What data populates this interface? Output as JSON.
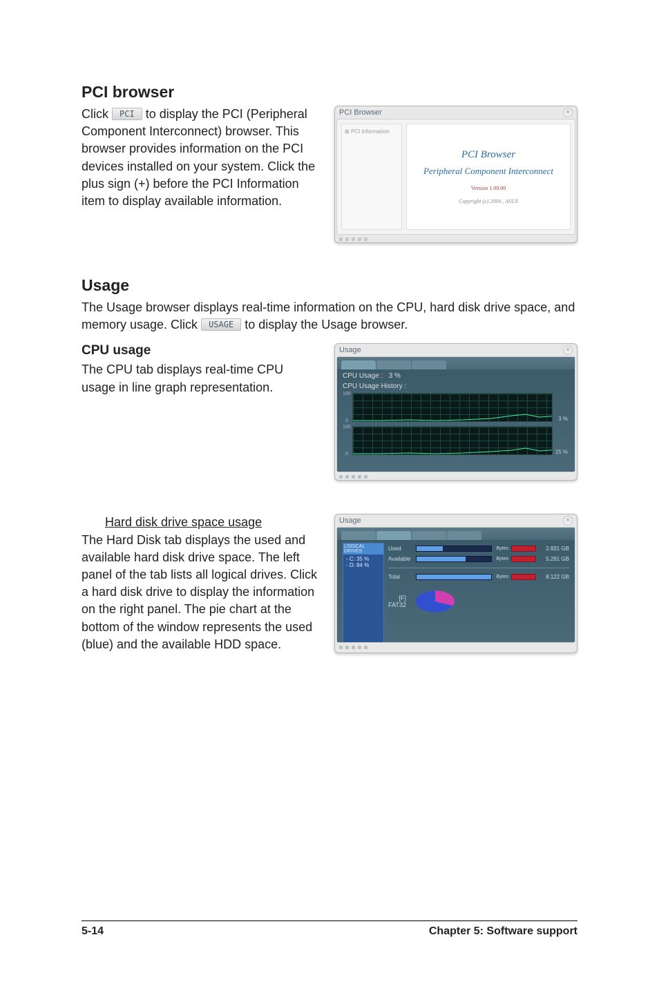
{
  "sections": {
    "pci": {
      "title": "PCI browser",
      "body_pre": "Click ",
      "btn": "PCI",
      "body_post": " to display the PCI (Peripheral Component Interconnect) browser. This browser provides information on the PCI devices installed on your system. Click the plus sign (+) before the PCI Information item to display available information."
    },
    "usage": {
      "title": "Usage",
      "intro_pre": "The Usage browser displays real-time information on the CPU, hard disk drive space, and memory usage. Click ",
      "btn": "USAGE",
      "intro_post": " to display the Usage browser."
    },
    "cpu": {
      "title": "CPU usage",
      "body": "The CPU tab displays real-time CPU usage in line graph representation."
    },
    "hdd": {
      "title": "Hard disk drive space usage",
      "body": "The Hard Disk tab displays the used and available hard disk drive space. The left panel of the tab lists all logical drives. Click a hard disk drive to display the information on the right panel. The pie chart at the bottom of the window represents the used (blue) and the available HDD space."
    }
  },
  "screenshots": {
    "pci": {
      "win_title": "PCI Browser",
      "tree_root": "PCI Information",
      "h1": "PCI  Browser",
      "h2": "Peripheral Component Interconnect",
      "ver": "Version 1.00.00",
      "copy": "Copyright (c) 2004 , ASUS"
    },
    "cpu": {
      "win_title": "Usage",
      "label1": "CPU Usage :",
      "val1": "3  %",
      "label2": "CPU Usage History :",
      "pct1": "3 %",
      "pct2": "15 %",
      "y_top": "100",
      "y_bot": "0"
    },
    "hdd": {
      "win_title": "Usage",
      "sidebar_hdr": "LOGICAL DRIVES",
      "drive1": "- C: 35 %",
      "drive2": "- D: 84 %",
      "rows": [
        {
          "label": "Used",
          "right": "2.831 GB"
        },
        {
          "label": "Available",
          "right": "5.291 GB"
        },
        {
          "label": "Total",
          "right": "8.122 GB"
        }
      ],
      "legend_free": "[F]",
      "legend_fat": "FAT32"
    }
  },
  "footer": {
    "page": "5-14",
    "chapter": "Chapter 5: Software support"
  },
  "chart_data": {
    "type": "pie",
    "title": "HDD space",
    "series": [
      {
        "name": "Used",
        "color": "#3050d0",
        "value": 70
      },
      {
        "name": "Available",
        "color": "#d040b0",
        "value": 30
      }
    ]
  }
}
